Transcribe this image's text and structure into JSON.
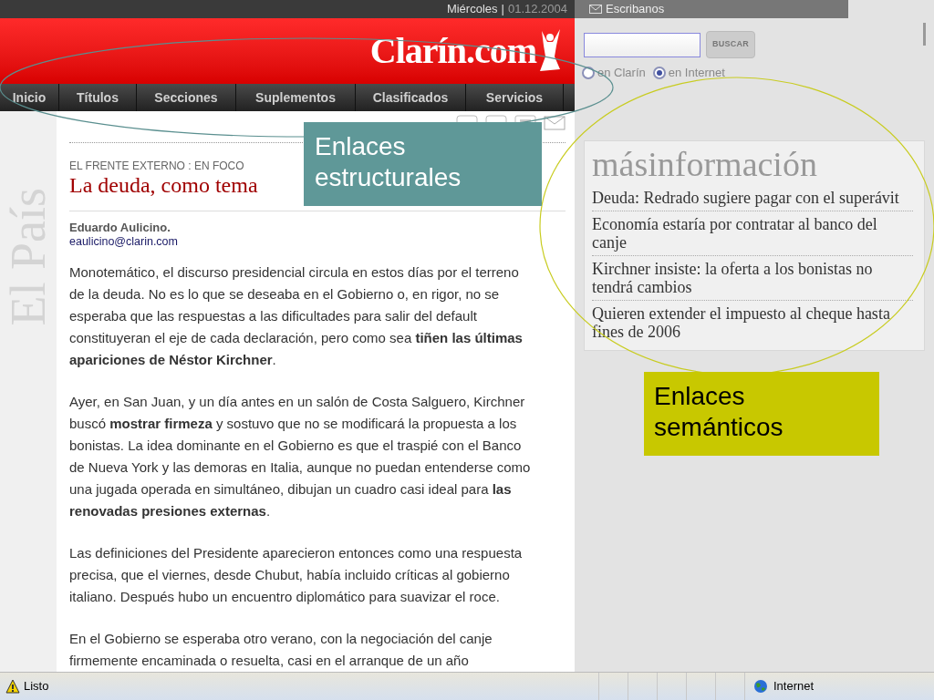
{
  "top_bar": {
    "day": "Miércoles",
    "separator": "|",
    "date": "01.12.2004",
    "contact": "Escribanos"
  },
  "header": {
    "logo": "Clarín.com"
  },
  "nav": [
    {
      "label": "Inicio"
    },
    {
      "label": "Títulos"
    },
    {
      "label": "Secciones"
    },
    {
      "label": "Suplementos"
    },
    {
      "label": "Clasificados"
    },
    {
      "label": "Servicios"
    }
  ],
  "section_label": "El País",
  "article": {
    "kicker": "EL FRENTE EXTERNO : EN FOCO",
    "headline": "La deuda, como tema",
    "author": "Eduardo Aulicino.",
    "email": "eaulicino@clarin.com",
    "paragraphs": [
      "Monotemático, el discurso presidencial circula en estos días por el terreno de la deuda. No es lo que se deseaba en el Gobierno o, en rigor, no se esperaba que las respuestas a las dificultades para salir del default constituyeran el eje de cada declaración, pero como sea **tiñen las últimas apariciones de Néstor Kirchner**.",
      "Ayer, en San Juan, y un día antes en un salón de Costa Salguero, Kirchner buscó **mostrar firmeza** y sostuvo que no se modificará la propuesta a los bonistas. La idea dominante en el Gobierno es que el traspié con el Banco de Nueva York y las demoras en Italia, aunque no puedan entenderse como una jugada operada en simultáneo, dibujan un cuadro casi ideal para **las renovadas presiones externas**.",
      "Las definiciones del Presidente aparecieron entonces como una respuesta precisa, que el viernes, desde Chubut, había incluido críticas al gobierno italiano. Después hubo un encuentro diplomático para suavizar el roce.",
      "En el Gobierno se esperaba otro verano, con la negociación del canje firmemente encaminada o resuelta, casi en el arranque de un año"
    ]
  },
  "search": {
    "button": "BUSCAR",
    "options": [
      {
        "label": "en Clarín",
        "selected": false
      },
      {
        "label": "en Internet",
        "selected": true
      }
    ]
  },
  "more_info": {
    "title": "másinformación",
    "links": [
      "Deuda: Redrado sugiere pagar con el superávit",
      "Economía estaría por contratar al banco del canje",
      "Kirchner insiste: la oferta a los bonistas no tendrá cambios",
      "Quieren extender el impuesto al cheque hasta fines de 2006"
    ]
  },
  "annotations": [
    {
      "kind": "structural",
      "text": "Enlaces estructurales"
    },
    {
      "kind": "semantic",
      "text": "Enlaces semánticos"
    }
  ],
  "status_bar": {
    "status": "Listo",
    "zone": "Internet"
  }
}
